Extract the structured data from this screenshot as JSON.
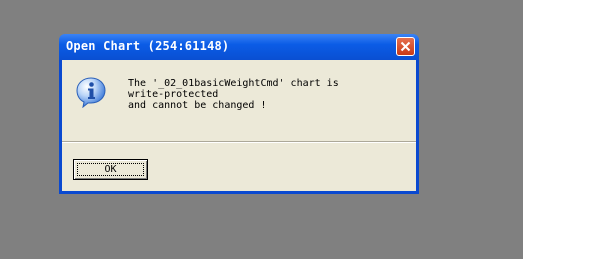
{
  "dialog": {
    "title": "Open Chart (254:61148)",
    "message": "The '_02_01basicWeightCmd' chart is\nwrite-protected\nand cannot be changed !",
    "ok_label": "OK",
    "icon": "info-icon",
    "close_icon": "close-icon"
  },
  "colors": {
    "desktop": "#808080",
    "titlebar": "#0a49d0",
    "dialog_body": "#ece9d8",
    "close_button": "#c93a17"
  }
}
